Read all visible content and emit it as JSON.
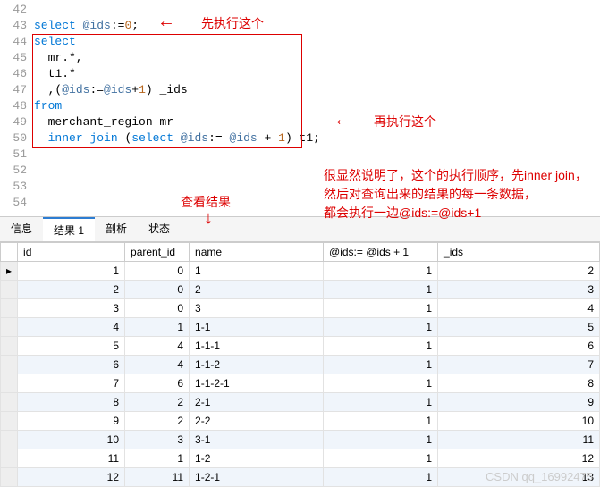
{
  "editor": {
    "lines": [
      {
        "n": 42,
        "html": ""
      },
      {
        "n": 43,
        "html": "<span class='kw'>select</span> <span class='var'>@ids</span>:=<span class='num'>0</span>;"
      },
      {
        "n": 44,
        "html": "<span class='kw'>select</span>"
      },
      {
        "n": 45,
        "html": "  mr.*,"
      },
      {
        "n": 46,
        "html": "  t1.*"
      },
      {
        "n": 47,
        "html": "  ,(<span class='var'>@ids</span>:=<span class='var'>@ids</span>+<span class='num'>1</span>) _ids"
      },
      {
        "n": 48,
        "html": "<span class='kw'>from</span>"
      },
      {
        "n": 49,
        "html": "  merchant_region mr"
      },
      {
        "n": 50,
        "html": "  <span class='kw'>inner</span> <span class='kw'>join</span> (<span class='kw'>select</span> <span class='var'>@ids</span>:= <span class='var'>@ids</span> + <span class='num'>1</span>) t1;"
      },
      {
        "n": 51,
        "html": ""
      },
      {
        "n": 52,
        "html": ""
      },
      {
        "n": 53,
        "html": ""
      },
      {
        "n": 54,
        "html": ""
      }
    ]
  },
  "annotations": {
    "a1": "先执行这个",
    "a2": "再执行这个",
    "a3": "查看结果",
    "a4": "很显然说明了，这个的执行顺序，先inner join，\n然后对查询出来的结果的每一条数据，\n都会执行一边@ids:=@ids+1"
  },
  "tabs": {
    "t1": "信息",
    "t2": "结果 1",
    "t3": "剖析",
    "t4": "状态"
  },
  "headers": {
    "h1": "id",
    "h2": "parent_id",
    "h3": "name",
    "h4": "@ids:= @ids + 1",
    "h5": "_ids"
  },
  "rows": [
    {
      "id": "1",
      "pid": "0",
      "name": "1",
      "v": "1",
      "ids": "2"
    },
    {
      "id": "2",
      "pid": "0",
      "name": "2",
      "v": "1",
      "ids": "3"
    },
    {
      "id": "3",
      "pid": "0",
      "name": "3",
      "v": "1",
      "ids": "4"
    },
    {
      "id": "4",
      "pid": "1",
      "name": "1-1",
      "v": "1",
      "ids": "5"
    },
    {
      "id": "5",
      "pid": "4",
      "name": "1-1-1",
      "v": "1",
      "ids": "6"
    },
    {
      "id": "6",
      "pid": "4",
      "name": "1-1-2",
      "v": "1",
      "ids": "7"
    },
    {
      "id": "7",
      "pid": "6",
      "name": "1-1-2-1",
      "v": "1",
      "ids": "8"
    },
    {
      "id": "8",
      "pid": "2",
      "name": "2-1",
      "v": "1",
      "ids": "9"
    },
    {
      "id": "9",
      "pid": "2",
      "name": "2-2",
      "v": "1",
      "ids": "10"
    },
    {
      "id": "10",
      "pid": "3",
      "name": "3-1",
      "v": "1",
      "ids": "11"
    },
    {
      "id": "11",
      "pid": "1",
      "name": "1-2",
      "v": "1",
      "ids": "12"
    },
    {
      "id": "12",
      "pid": "11",
      "name": "1-2-1",
      "v": "1",
      "ids": "13"
    }
  ],
  "watermark": "CSDN qq_16992475"
}
